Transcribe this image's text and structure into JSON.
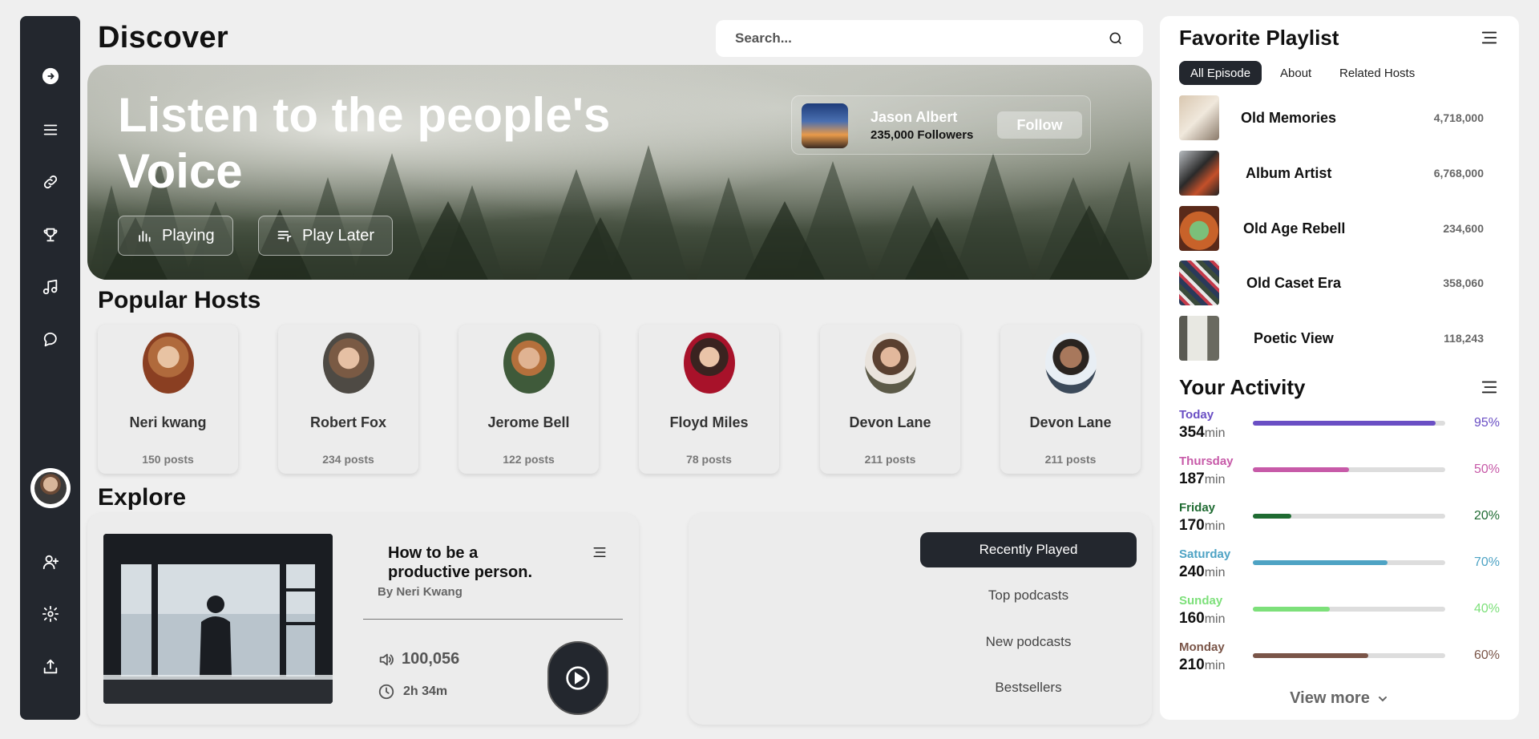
{
  "header": {
    "title": "Discover",
    "search_placeholder": "Search..."
  },
  "hero": {
    "title": "Listen to the people's Voice",
    "playing_label": "Playing",
    "play_later_label": "Play Later",
    "host": {
      "name": "Jason Albert",
      "followers": "235,000 Followers",
      "follow_label": "Follow"
    }
  },
  "popular_hosts": {
    "title": "Popular Hosts",
    "items": [
      {
        "name": "Neri kwang",
        "posts": "150 posts"
      },
      {
        "name": "Robert Fox",
        "posts": "234 posts"
      },
      {
        "name": "Jerome Bell",
        "posts": "122 posts"
      },
      {
        "name": "Floyd Miles",
        "posts": "78 posts"
      },
      {
        "name": "Devon Lane",
        "posts": "211 posts"
      },
      {
        "name": "Devon Lane",
        "posts": "211 posts"
      }
    ]
  },
  "explore": {
    "title": "Explore",
    "card": {
      "title": "How to be a productive person.",
      "author": "By Neri Kwang",
      "listeners": "100,056",
      "duration": "2h 34m"
    },
    "categories": [
      "Recently Played",
      "Top podcasts",
      "New podcasts",
      "Bestsellers"
    ]
  },
  "favorite_playlist": {
    "title": "Favorite Playlist",
    "tabs": [
      "All Episode",
      "About",
      "Related Hosts"
    ],
    "items": [
      {
        "name": "Old Memories",
        "count": "4,718,000"
      },
      {
        "name": "Album Artist",
        "count": "6,768,000"
      },
      {
        "name": "Old Age Rebell",
        "count": "234,600"
      },
      {
        "name": "Old Caset Era",
        "count": "358,060"
      },
      {
        "name": "Poetic View",
        "count": "118,243"
      }
    ]
  },
  "activity": {
    "title": "Your Activity",
    "unit": "min",
    "items": [
      {
        "day": "Today",
        "minutes": "354",
        "percent": "95%",
        "level": 0.95,
        "color": "#6a4fc4"
      },
      {
        "day": "Thursday",
        "minutes": "187",
        "percent": "50%",
        "level": 0.5,
        "color": "#c75aa8"
      },
      {
        "day": "Friday",
        "minutes": "170",
        "percent": "20%",
        "level": 0.2,
        "color": "#1f6b32"
      },
      {
        "day": "Saturday",
        "minutes": "240",
        "percent": "70%",
        "level": 0.7,
        "color": "#4ea3c4"
      },
      {
        "day": "Sunday",
        "minutes": "160",
        "percent": "40%",
        "level": 0.4,
        "color": "#7de07a"
      },
      {
        "day": "Monday",
        "minutes": "210",
        "percent": "60%",
        "level": 0.6,
        "color": "#7a5548"
      }
    ],
    "view_more": "View more"
  }
}
